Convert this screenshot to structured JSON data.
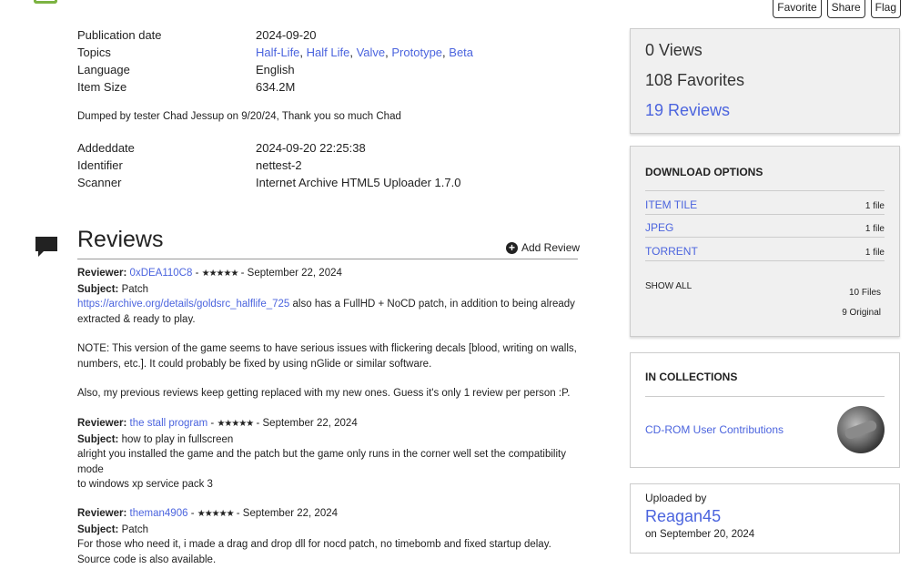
{
  "top_buttons": [
    "Favorite",
    "Share",
    "Flag"
  ],
  "metadata_top": [
    {
      "key": "Publication date",
      "value": "2024-09-20",
      "link": true
    },
    {
      "key": "Topics",
      "topics": [
        "Half-Life",
        "Half Life",
        "Valve",
        "Prototype",
        "Beta"
      ]
    },
    {
      "key": "Language",
      "value": "English",
      "link": true
    },
    {
      "key": "Item Size",
      "value": "634.2M",
      "link": false
    }
  ],
  "description": "Dumped by tester Chad Jessup on 9/20/24, Thank you so much Chad",
  "metadata_bottom": [
    {
      "key": "Addeddate",
      "value": "2024-09-20 22:25:38"
    },
    {
      "key": "Identifier",
      "value": "nettest-2"
    },
    {
      "key": "Scanner",
      "value": "Internet Archive HTML5 Uploader 1.7.0"
    }
  ],
  "reviews": {
    "title": "Reviews",
    "add_label": "Add Review",
    "items": [
      {
        "reviewer_label": "Reviewer:",
        "reviewer": "0xDEA110C8",
        "stars": "★★★★★",
        "date": "September 22, 2024",
        "subject_label": "Subject:",
        "subject": "Patch",
        "link": "https://archive.org/details/goldsrc_halflife_725",
        "body1": " also has a FullHD + NoCD patch, in addition to being already extracted & ready to play.",
        "body2": "NOTE: This version of the game seems to have serious issues with flickering decals [blood, writing on walls, numbers, etc.]. It could probably be fixed by using nGlide or similar software.",
        "body3": "Also, my previous reviews keep getting replaced with my new ones. Guess it's only 1 review per person :P."
      },
      {
        "reviewer_label": "Reviewer:",
        "reviewer": "the stall program",
        "stars": "★★★★★",
        "date": "September 22, 2024",
        "subject_label": "Subject:",
        "subject": "how to play in fullscreen",
        "body1": "alright you installed the game and the patch but the game only runs in the corner well set the compatibility mode",
        "body2": "to windows xp service pack 3"
      },
      {
        "reviewer_label": "Reviewer:",
        "reviewer": "theman4906",
        "stars": "★★★★★",
        "date": "September 22, 2024",
        "subject_label": "Subject:",
        "subject": "Patch",
        "body1": "For those who need it, i made a drag and drop dll for nocd patch, no timebomb and fixed startup delay.",
        "body2": "Source code is also available."
      }
    ]
  },
  "stats": {
    "views": "0 Views",
    "favorites": "108 Favorites",
    "reviews": "19 Reviews"
  },
  "download": {
    "title": "DOWNLOAD OPTIONS",
    "rows": [
      {
        "label": "ITEM TILE",
        "count": "1 file"
      },
      {
        "label": "JPEG",
        "count": "1 file"
      },
      {
        "label": "TORRENT",
        "count": "1 file"
      }
    ],
    "show_all": "SHOW ALL",
    "files": "10 Files",
    "original": "9 Original"
  },
  "collections": {
    "title": "IN COLLECTIONS",
    "item": "CD-ROM User Contributions"
  },
  "uploader": {
    "label": "Uploaded by",
    "name": "Reagan45",
    "date": "on September 20, 2024"
  }
}
